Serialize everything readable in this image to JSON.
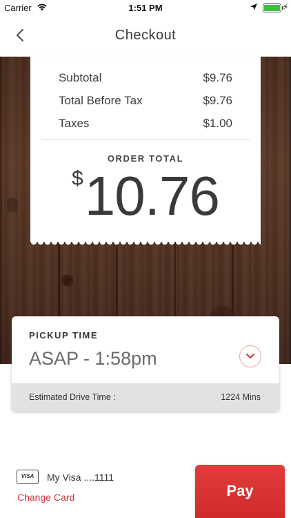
{
  "status_bar": {
    "carrier": "Carrier",
    "time": "1:51 PM"
  },
  "nav": {
    "title": "Checkout"
  },
  "receipt": {
    "subtotal_label": "Subtotal",
    "subtotal_value": "$9.76",
    "before_tax_label": "Total Before Tax",
    "before_tax_value": "$9.76",
    "taxes_label": "Taxes",
    "taxes_value": "$1.00",
    "order_total_label": "ORDER TOTAL",
    "currency": "$",
    "order_total_value": "10.76"
  },
  "pickup": {
    "label": "PICKUP TIME",
    "value": "ASAP - 1:58pm",
    "drive_label": "Estimated Drive Time :",
    "drive_value": "1224 Mins"
  },
  "payment": {
    "card_brand": "VISA",
    "card_name": "My Visa ....1111",
    "change_label": "Change Card",
    "pay_label": "Pay"
  },
  "colors": {
    "accent": "#d0333a",
    "pay_button": "#e23c3c",
    "wood": "#5b3826"
  },
  "icons": [
    "wifi-icon",
    "location-icon",
    "battery-icon",
    "back-chevron-icon",
    "chevron-down-icon",
    "visa-card-icon"
  ]
}
